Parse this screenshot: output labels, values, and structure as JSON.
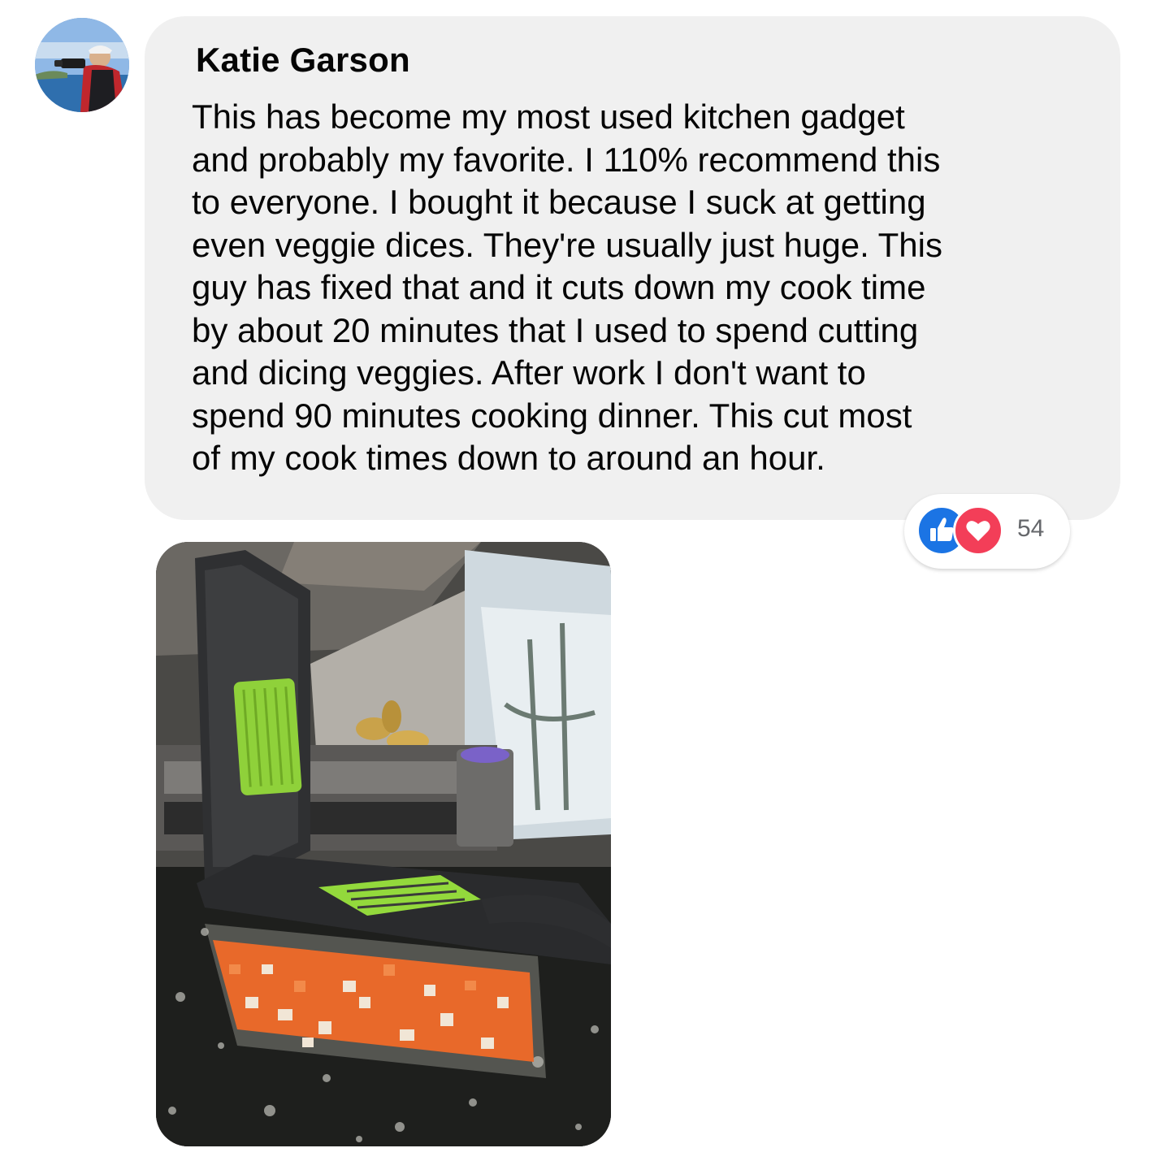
{
  "comment": {
    "author": "Katie Garson",
    "lines": [
      "This has become my most used kitchen gadget",
      "and probably my favorite. I 110% recommend this",
      "to everyone. I bought it because I suck at getting",
      "even veggie dices. They're usually just huge. This",
      "guy has fixed that and it cuts down my cook time",
      "by about 20 minutes that I used to spend cutting",
      "and dicing veggies. After work I don't want to",
      "spend 90 minutes cooking dinner. This cut most",
      "of my cook times down to around an hour."
    ],
    "reactions": {
      "icons": [
        "like-icon",
        "love-icon"
      ],
      "count": "54"
    }
  },
  "colors": {
    "bubble": "#f0f0f0",
    "like": "#1b74e4",
    "love": "#f33e58",
    "text": "#050505",
    "muted": "#65676b"
  }
}
